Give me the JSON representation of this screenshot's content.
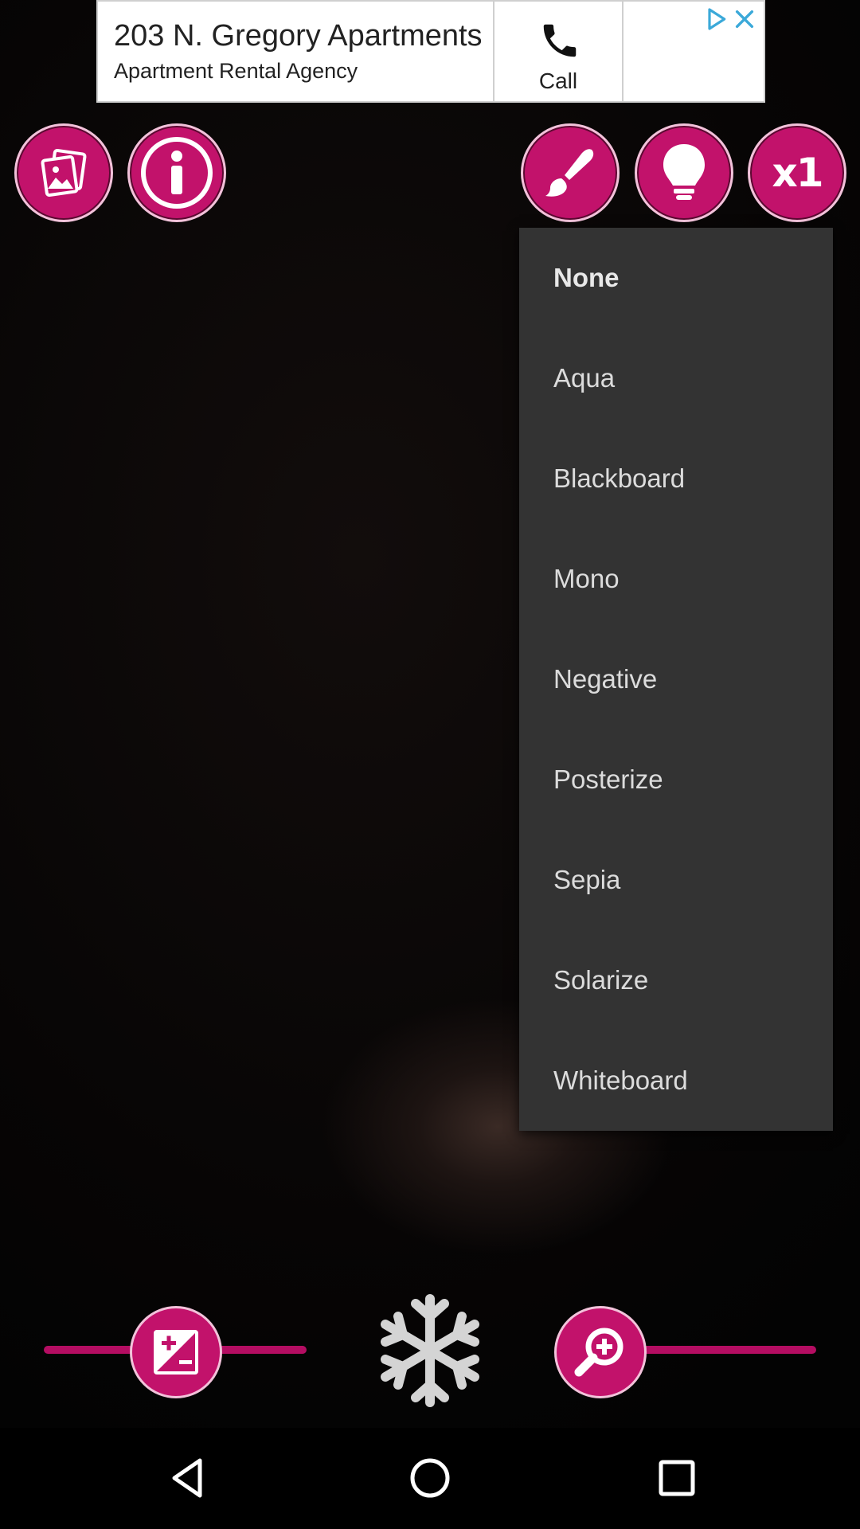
{
  "ad": {
    "title": "203 N. Gregory Apartments",
    "subtitle": "Apartment Rental Agency",
    "call_label": "Call",
    "icons": [
      "phone-icon",
      "adchoices-play-icon",
      "close-icon"
    ]
  },
  "toolbar": {
    "buttons": [
      "gallery-icon",
      "info-icon",
      "brush-icon",
      "bulb-icon",
      "zoom-level"
    ],
    "zoom_level": "x1"
  },
  "effects_menu": {
    "selected": "None",
    "items": [
      {
        "label": "None"
      },
      {
        "label": "Aqua"
      },
      {
        "label": "Blackboard"
      },
      {
        "label": "Mono"
      },
      {
        "label": "Negative"
      },
      {
        "label": "Posterize"
      },
      {
        "label": "Sepia"
      },
      {
        "label": "Solarize"
      },
      {
        "label": "Whiteboard"
      }
    ]
  },
  "bottom_controls": {
    "icons": [
      "exposure-icon",
      "snowflake-icon",
      "zoom-in-icon"
    ]
  },
  "nav_bar": {
    "icons": [
      "back-icon",
      "home-icon",
      "recent-apps-icon"
    ]
  },
  "colors": {
    "accent": "#c2126b",
    "accent_border": "#f2c2da",
    "menu_background": "#333333",
    "menu_text": "#dcdcdc"
  }
}
